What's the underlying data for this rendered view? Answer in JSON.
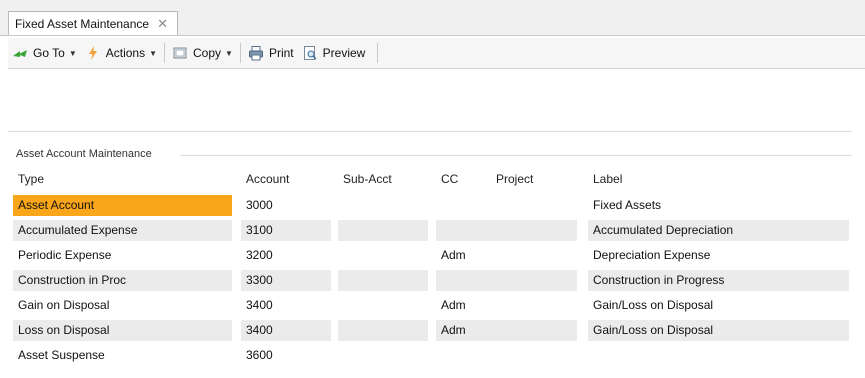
{
  "tab": {
    "title": "Fixed Asset Maintenance",
    "close_glyph": "✕"
  },
  "toolbar": {
    "goto_label": "Go To",
    "actions_label": "Actions",
    "copy_label": "Copy",
    "print_label": "Print",
    "preview_label": "Preview"
  },
  "group": {
    "title": "Asset Account Maintenance"
  },
  "columns": {
    "type": "Type",
    "account": "Account",
    "subacct": "Sub-Acct",
    "cc": "CC",
    "project": "Project",
    "label": "Label"
  },
  "rows": [
    {
      "type": "Asset Account",
      "account": "3000",
      "subacct": "",
      "cc": "",
      "project": "",
      "label": "Fixed Assets",
      "selected": true
    },
    {
      "type": "Accumulated Expense",
      "account": "3100",
      "subacct": "",
      "cc": "",
      "project": "",
      "label": "Accumulated Depreciation"
    },
    {
      "type": "Periodic Expense",
      "account": "3200",
      "subacct": "",
      "cc": "Adm",
      "project": "",
      "label": "Depreciation Expense"
    },
    {
      "type": "Construction in Proc",
      "account": "3300",
      "subacct": "",
      "cc": "",
      "project": "",
      "label": "Construction in Progress"
    },
    {
      "type": "Gain on Disposal",
      "account": "3400",
      "subacct": "",
      "cc": "Adm",
      "project": "",
      "label": "Gain/Loss on Disposal"
    },
    {
      "type": "Loss on Disposal",
      "account": "3400",
      "subacct": "",
      "cc": "Adm",
      "project": "",
      "label": "Gain/Loss on Disposal"
    },
    {
      "type": "Asset Suspense",
      "account": "3600",
      "subacct": "",
      "cc": "",
      "project": "",
      "label": ""
    }
  ],
  "colors": {
    "selected": "#f9a61a",
    "shade": "#ebebeb"
  },
  "icons": [
    "go-to-icon",
    "actions-icon",
    "copy-icon",
    "print-icon",
    "preview-icon",
    "close-icon"
  ]
}
